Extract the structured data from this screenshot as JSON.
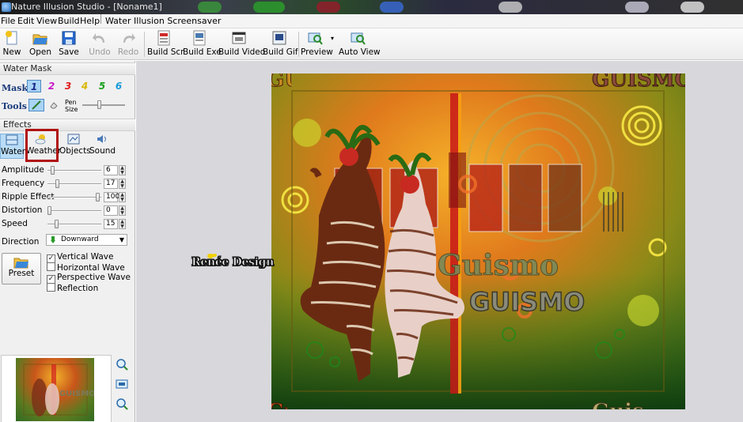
{
  "window": {
    "title": "Nature Illusion Studio - [Noname1]"
  },
  "menu": {
    "items": [
      "File",
      "Edit",
      "View",
      "Build",
      "Help"
    ],
    "extra": "Water Illusion Screensaver"
  },
  "toolbar": {
    "buttons": [
      {
        "label": "New",
        "icon": "new-file-icon",
        "enabled": true
      },
      {
        "label": "Open",
        "icon": "open-folder-icon",
        "enabled": true
      },
      {
        "label": "Save",
        "icon": "save-disk-icon",
        "enabled": true
      },
      {
        "label": "Undo",
        "icon": "undo-icon",
        "enabled": false
      },
      {
        "label": "Redo",
        "icon": "redo-icon",
        "enabled": false
      },
      {
        "label": "Build Scr",
        "icon": "build-scr-icon",
        "enabled": true
      },
      {
        "label": "Build Exe",
        "icon": "build-exe-icon",
        "enabled": true
      },
      {
        "label": "Build Video",
        "icon": "build-video-icon",
        "enabled": true
      },
      {
        "label": "Build Gif",
        "icon": "build-gif-icon",
        "enabled": true
      },
      {
        "label": "Preview",
        "icon": "preview-icon",
        "enabled": true
      },
      {
        "label": "Auto View",
        "icon": "auto-view-icon",
        "enabled": true
      }
    ]
  },
  "water_mask": {
    "header": "Water Mask",
    "mask_label": "Mask",
    "mask_numbers": [
      "1",
      "2",
      "3",
      "4",
      "5",
      "6"
    ],
    "mask_colors": [
      "#1a2a8a",
      "#c81ac8",
      "#e01818",
      "#e0c800",
      "#1aa01a",
      "#1a9ad8"
    ],
    "selected_mask": "1",
    "tools_label": "Tools",
    "pen_size_label": "Pen Size",
    "pen_size_level": 0.4
  },
  "effects": {
    "header": "Effects",
    "tabs": [
      "Water",
      "Weather",
      "Objects",
      "Sound"
    ],
    "selected_tab": "Water",
    "highlighted_tab": "Weather"
  },
  "params": [
    {
      "label": "Amplitude",
      "value": "6",
      "level": 0.06
    },
    {
      "label": "Frequency",
      "value": "17",
      "level": 0.17
    },
    {
      "label": "Ripple Effect",
      "value": "100",
      "level": 1.0
    },
    {
      "label": "Distortion",
      "value": "0",
      "level": 0.0
    },
    {
      "label": "Speed",
      "value": "15",
      "level": 0.15
    }
  ],
  "direction": {
    "label": "Direction",
    "value": "Downward"
  },
  "preset": {
    "label": "Preset"
  },
  "options": [
    {
      "label": "Vertical Wave",
      "checked": true
    },
    {
      "label": "Horizontal Wave",
      "checked": false
    },
    {
      "label": "Perspective Wave",
      "checked": true
    },
    {
      "label": "Reflection",
      "checked": false
    }
  ],
  "side_icons": [
    "zoom-in-icon",
    "fit-window-icon",
    "zoom-out-icon"
  ],
  "canvas": {
    "watermark": "Renée Design",
    "text_large": "GUISMO",
    "text_small": "Guismo",
    "text_top": "GUISMO",
    "text_bottom": "Guis"
  },
  "colors": {
    "selection": "#a9d4f5",
    "highlight_box": "#b01212",
    "workspace": "#d8d8dc"
  }
}
